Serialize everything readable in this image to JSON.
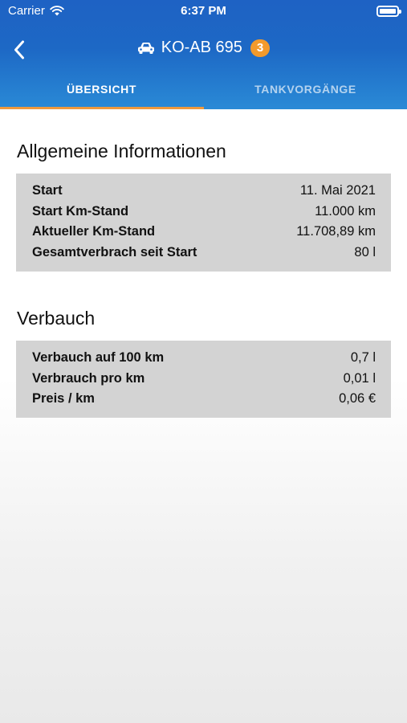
{
  "status_bar": {
    "carrier": "Carrier",
    "time": "6:37 PM"
  },
  "nav": {
    "title": "KO-AB 695",
    "badge": "3"
  },
  "tabs": [
    {
      "label": "ÜBERSICHT",
      "active": true
    },
    {
      "label": "TANKVORGÄNGE",
      "active": false
    }
  ],
  "general": {
    "title": "Allgemeine Informationen",
    "rows": [
      {
        "label": "Start",
        "value": "11. Mai 2021"
      },
      {
        "label": "Start Km-Stand",
        "value": "11.000 km"
      },
      {
        "label": "Aktueller Km-Stand",
        "value": "11.708,89 km"
      },
      {
        "label": "Gesamtverbrach seit Start",
        "value": "80 l"
      }
    ]
  },
  "consumption": {
    "title": "Verbauch",
    "rows": [
      {
        "label": "Verbauch auf 100 km",
        "value": "0,7 l"
      },
      {
        "label": "Verbrauch pro km",
        "value": "0,01 l"
      },
      {
        "label": "Preis / km",
        "value": "0,06 €"
      }
    ]
  },
  "colors": {
    "header": "#1e62c4",
    "accent": "#f29a2c",
    "card": "#d3d3d3"
  },
  "icons": [
    "wifi-icon",
    "battery-icon",
    "back-chevron-icon",
    "car-icon"
  ]
}
